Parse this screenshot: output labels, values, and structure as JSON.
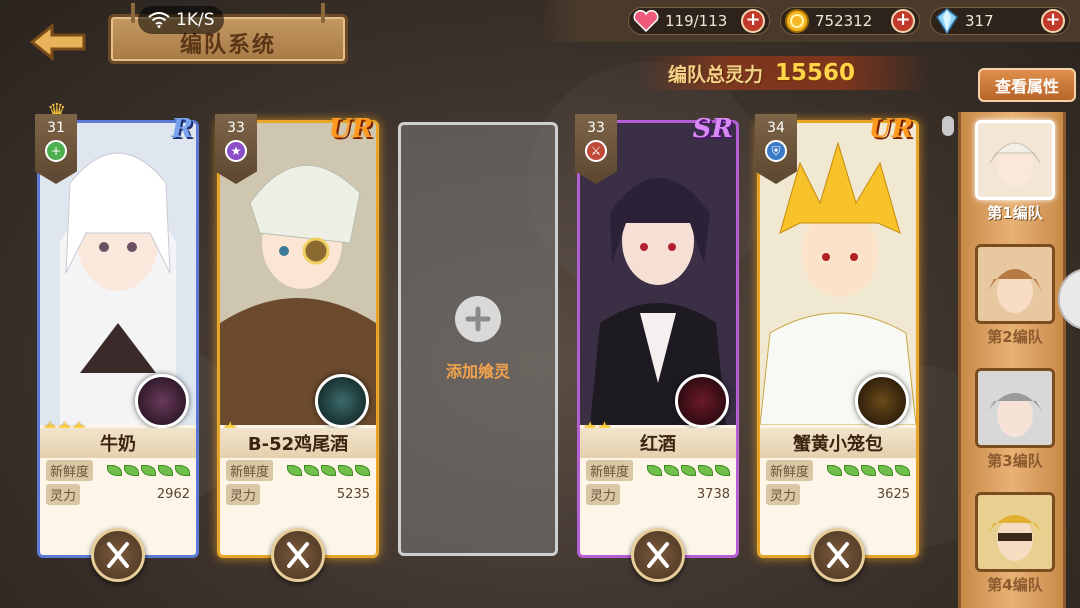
{
  "header": {
    "title": "编队系统",
    "net_speed": "1K/S"
  },
  "resources": [
    {
      "icon": "heart-icon",
      "value": "119/113"
    },
    {
      "icon": "gold-coin-icon",
      "value": "752312"
    },
    {
      "icon": "crystal-icon",
      "value": "317"
    }
  ],
  "team_power": {
    "label": "编队总灵力",
    "value": "15560"
  },
  "view_attributes_label": "查看属性",
  "cards": [
    {
      "name": "牛奶",
      "level": "31",
      "rarity": "R",
      "stars": "★★★",
      "freshness_label": "新鲜度",
      "power_label": "灵力",
      "power": "2962",
      "freshness_leaves": 5,
      "leader": true
    },
    {
      "name": "B-52鸡尾酒",
      "level": "33",
      "rarity": "UR",
      "stars": "★",
      "freshness_label": "新鲜度",
      "power_label": "灵力",
      "power": "5235",
      "freshness_leaves": 5,
      "leader": false
    },
    {
      "name": "红酒",
      "level": "33",
      "rarity": "SR",
      "stars": "★★",
      "freshness_label": "新鲜度",
      "power_label": "灵力",
      "power": "3738",
      "freshness_leaves": 5,
      "leader": false
    },
    {
      "name": "蟹黄小笼包",
      "level": "34",
      "rarity": "UR",
      "stars": "",
      "freshness_label": "新鲜度",
      "power_label": "灵力",
      "power": "3625",
      "freshness_leaves": 5,
      "leader": false
    }
  ],
  "empty_slot": {
    "label": "添加飨灵"
  },
  "teams": [
    {
      "label": "第1编队",
      "active": true
    },
    {
      "label": "第2编队",
      "active": false
    },
    {
      "label": "第3编队",
      "active": false
    },
    {
      "label": "第4编队",
      "active": false
    }
  ]
}
